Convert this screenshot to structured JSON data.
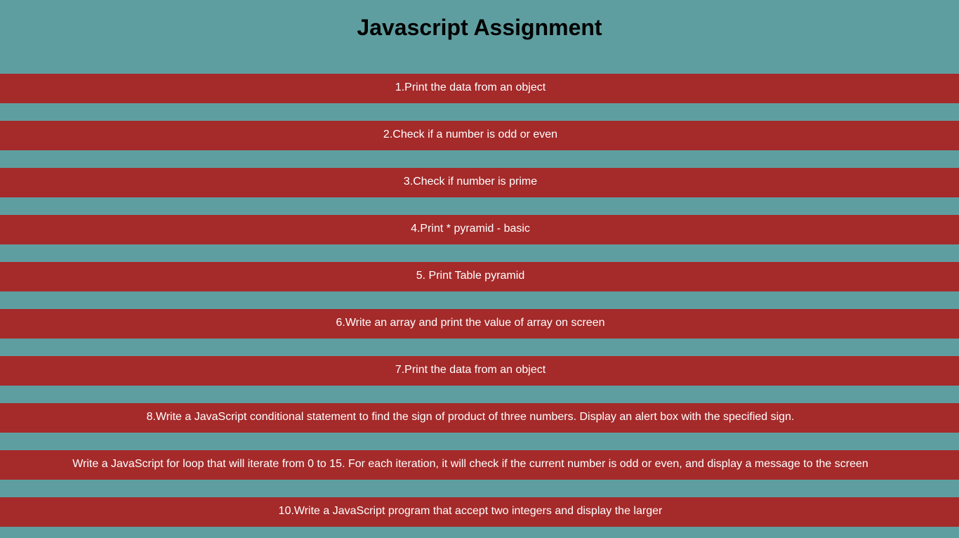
{
  "page": {
    "title": "Javascript Assignment"
  },
  "colors": {
    "background": "#5f9ea0",
    "item_background": "#a52a2a",
    "item_text": "#ffffff",
    "title_text": "#000000"
  },
  "assignments": [
    {
      "label": "1.Print the data from an object"
    },
    {
      "label": "2.Check if a number is odd or even"
    },
    {
      "label": "3.Check if number is prime"
    },
    {
      "label": "4.Print * pyramid - basic"
    },
    {
      "label": "5. Print Table pyramid"
    },
    {
      "label": "6.Write an array and print the value of array on screen"
    },
    {
      "label": "7.Print the data from an object"
    },
    {
      "label": "8.Write a JavaScript conditional statement to find the sign of product of three numbers. Display an alert box with the specified sign."
    },
    {
      "label": "Write a JavaScript for loop that will iterate from 0 to 15. For each iteration, it will check if the current number is odd or even, and display a message to the screen"
    },
    {
      "label": "10.Write a JavaScript program that accept two integers and display the larger"
    }
  ]
}
